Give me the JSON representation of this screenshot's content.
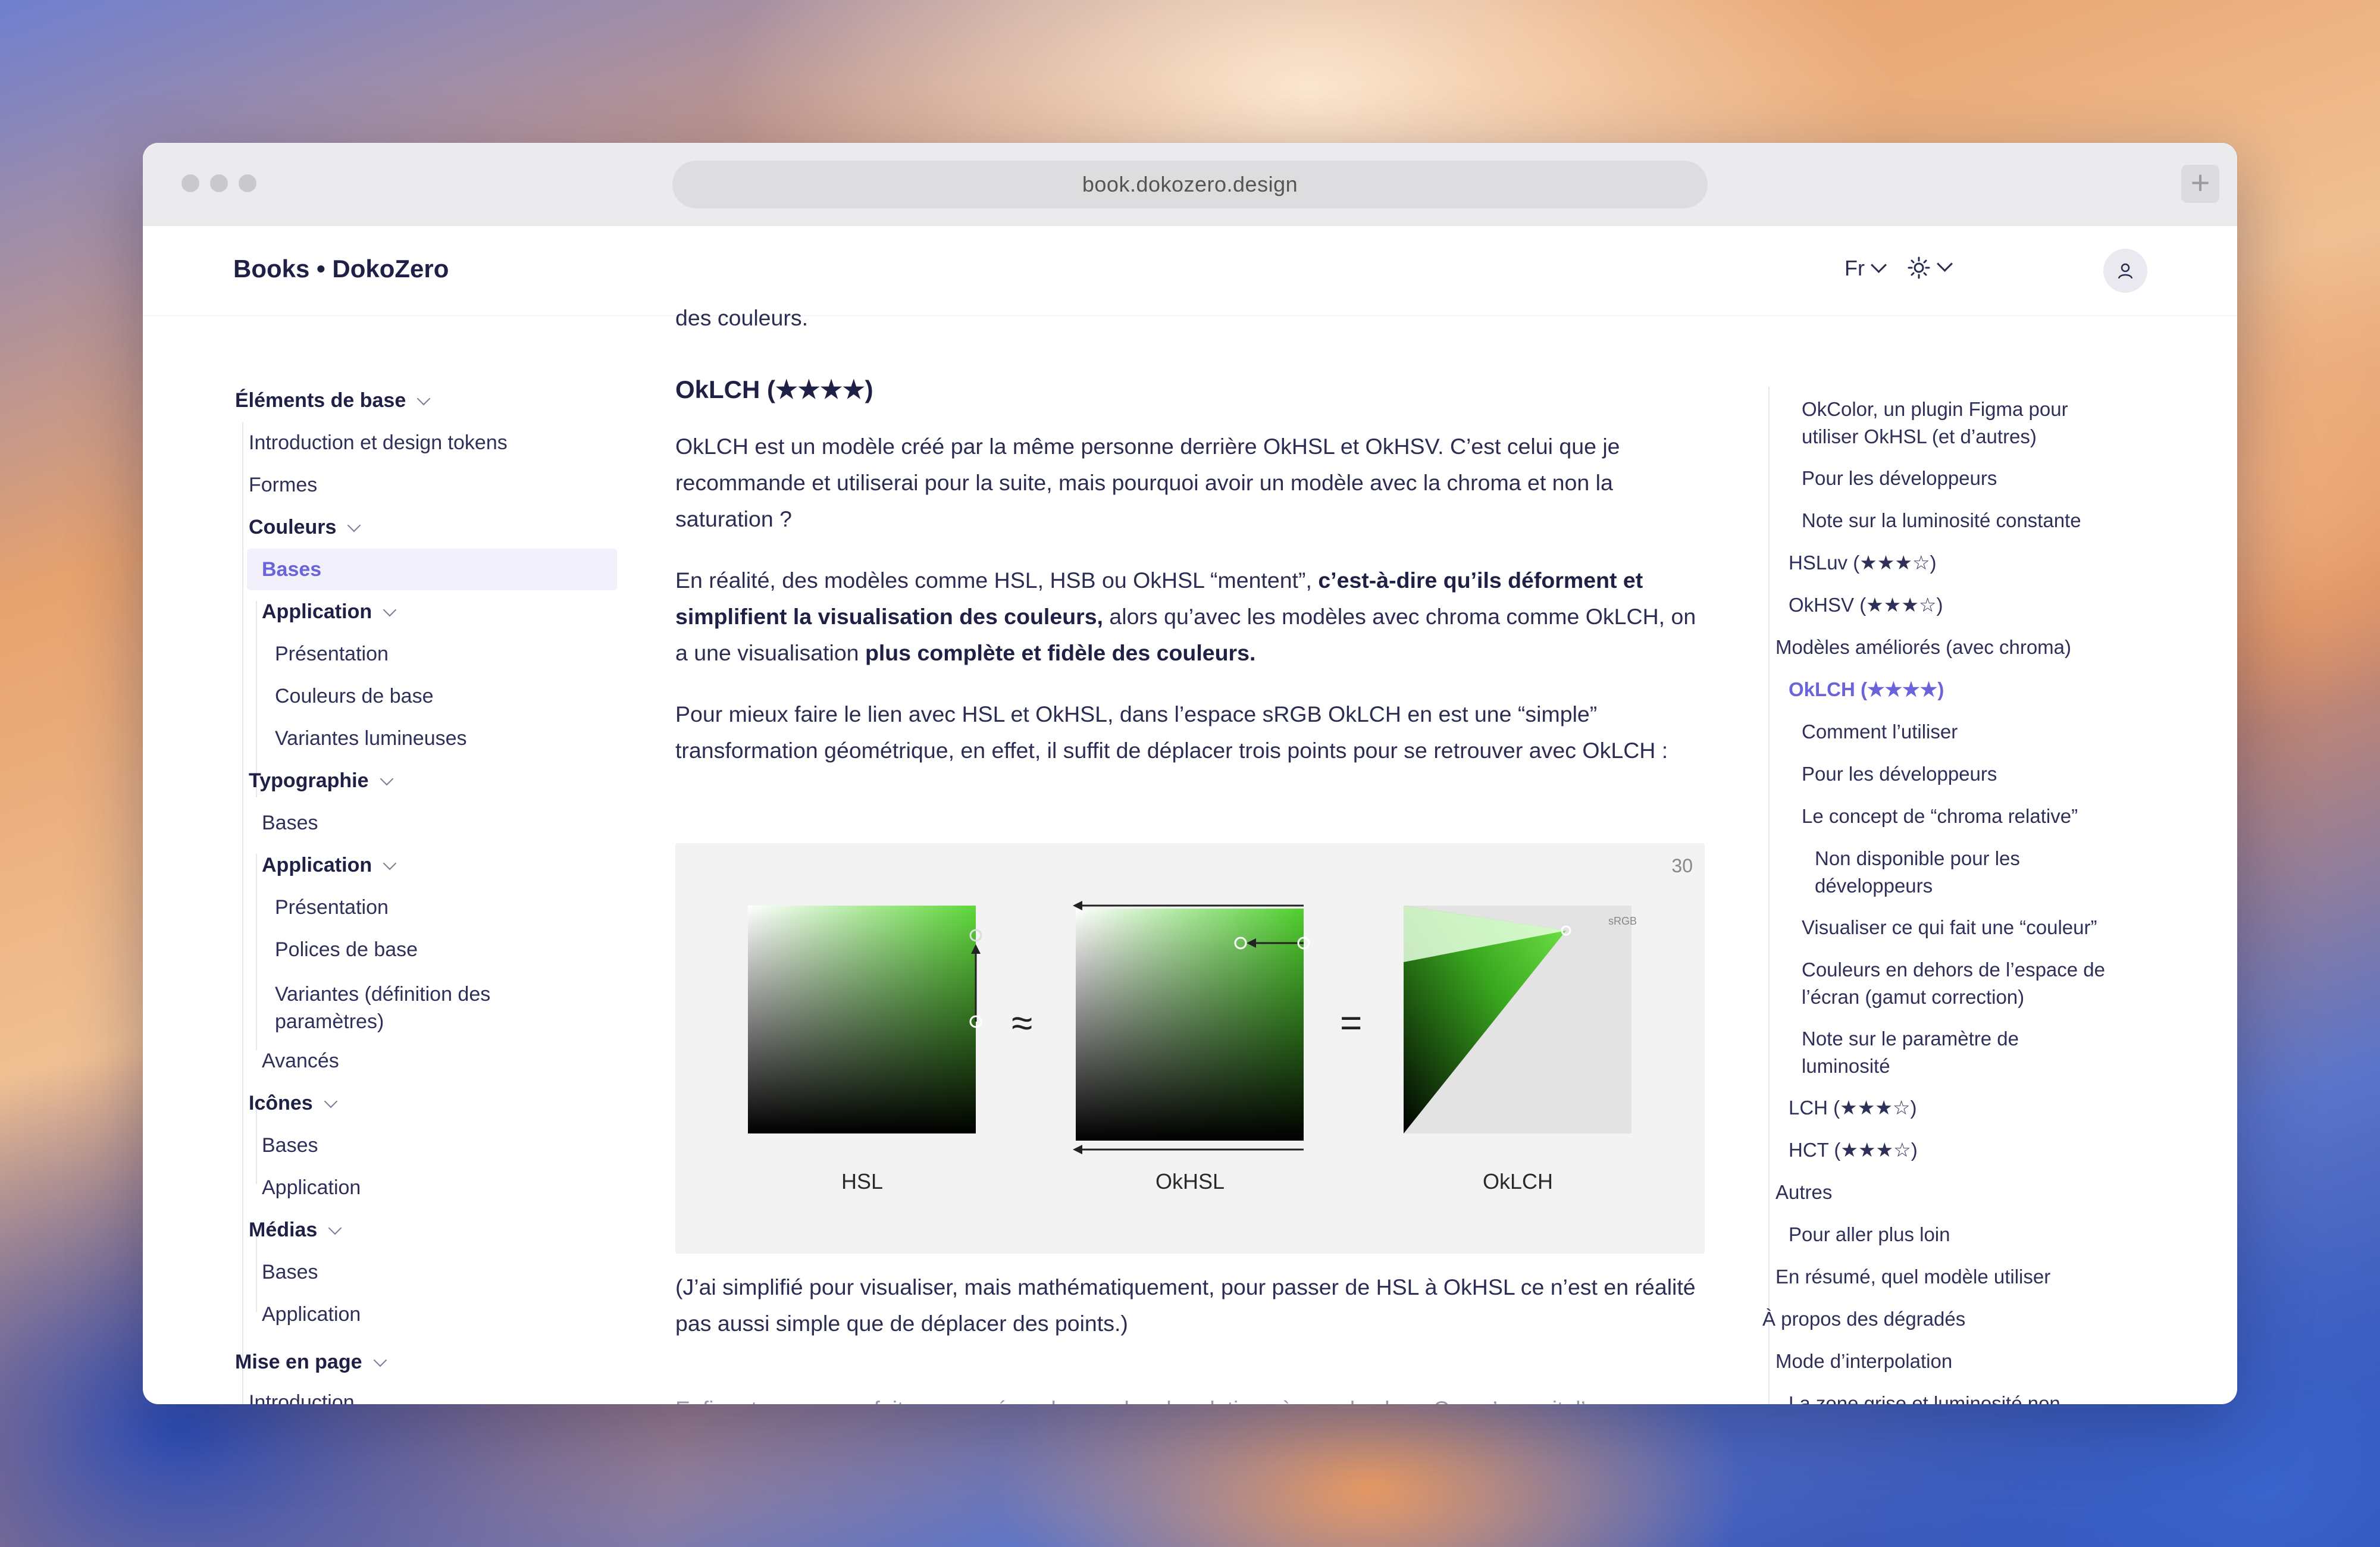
{
  "browser": {
    "url": "book.dokozero.design",
    "new_tab_label": "+"
  },
  "header": {
    "brand": "Books • DokoZero",
    "language": "Fr",
    "theme_icon": "sun-icon",
    "user_icon": "user-icon"
  },
  "left_nav": {
    "sections": [
      {
        "label": "Éléments de base"
      },
      {
        "label": "Mise en page"
      }
    ],
    "items": {
      "intro": "Introduction et design tokens",
      "formes": "Formes",
      "couleurs": "Couleurs",
      "couleurs_bases": "Bases",
      "couleurs_application": "Application",
      "presentation1": "Présentation",
      "couleurs_de_base": "Couleurs de base",
      "variantes_lumineuses": "Variantes lumineuses",
      "typographie": "Typographie",
      "typo_bases": "Bases",
      "typo_application": "Application",
      "presentation2": "Présentation",
      "polices_de_base": "Polices de base",
      "variantes_def": "Variantes (définition des",
      "variantes_def_2": "paramètres)",
      "avances": "Avancés",
      "icones": "Icônes",
      "icones_bases": "Bases",
      "icones_application": "Application",
      "medias": "Médias",
      "medias_bases": "Bases",
      "medias_application": "Application",
      "introduction_cut": "Introduction"
    }
  },
  "main": {
    "top_fragment": "des couleurs.",
    "heading": "OkLCH (★★★★)",
    "p1": "OkLCH est un modèle créé par la même personne derrière OkHSL et OkHSV. C’est celui que je recommande et utiliserai pour la suite, mais pourquoi avoir un modèle avec la chroma et non la saturation ?",
    "p2_a": "En réalité, des modèles comme HSL, HSB ou OkHSL “mentent”, ",
    "p2_b": "c’est-à-dire qu’ils déforment et simplifient la visualisation des couleurs,",
    "p2_c": " alors qu’avec les modèles avec chroma comme OkLCH, on a une visualisation ",
    "p2_d": "plus complète et fidèle des couleurs.",
    "p3": "Pour mieux faire le lien avec HSL et OkHSL, dans l’espace sRGB OkLCH en est une “simple” transformation géométrique, en effet, il suffit de déplacer trois points pour se retrouver avec OkLCH :",
    "p4": "(J’ai simplifié pour visualiser, mais mathématiquement, pour passer de HSL à OkHSL ce n’est en réalité pas aussi simple que de déplacer des points.)",
    "p5_cut": "Enfin, et comme on fait mon pavé sur les modes de relations à pour les bas. Ce qu’on sait, l’on enrevent"
  },
  "figure": {
    "number": "30",
    "labels": [
      "HSL",
      "OkHSL",
      "OkLCH"
    ],
    "symbols": [
      "≈",
      "="
    ],
    "srgb_tag": "sRGB",
    "accent": "#5ed83a"
  },
  "toc": {
    "items": [
      "OkColor, un plugin Figma pour",
      "utiliser OkHSL (et d’autres)",
      "Pour les développeurs",
      "Note sur la luminosité constante",
      "HSLuv (★★★☆)",
      "OkHSV (★★★☆)",
      "Modèles améliorés (avec chroma)",
      "OkLCH (★★★★)",
      "Comment l’utiliser",
      "Pour les développeurs",
      "Le concept de “chroma relative”",
      "Non disponible pour les",
      "développeurs",
      "Visualiser ce qui fait une “couleur”",
      "Couleurs en dehors de l’espace de",
      "l’écran (gamut correction)",
      "Note sur le paramètre de",
      "luminosité",
      "LCH (★★★☆)",
      "HCT (★★★☆)",
      "Autres",
      "Pour aller plus loin",
      "En résumé, quel modèle utiliser",
      "À propos des dégradés",
      "Mode d’interpolation",
      "La zone grise et luminosité non"
    ]
  },
  "colors": {
    "accent": "#6b63d9",
    "text": "#2c2d52"
  }
}
